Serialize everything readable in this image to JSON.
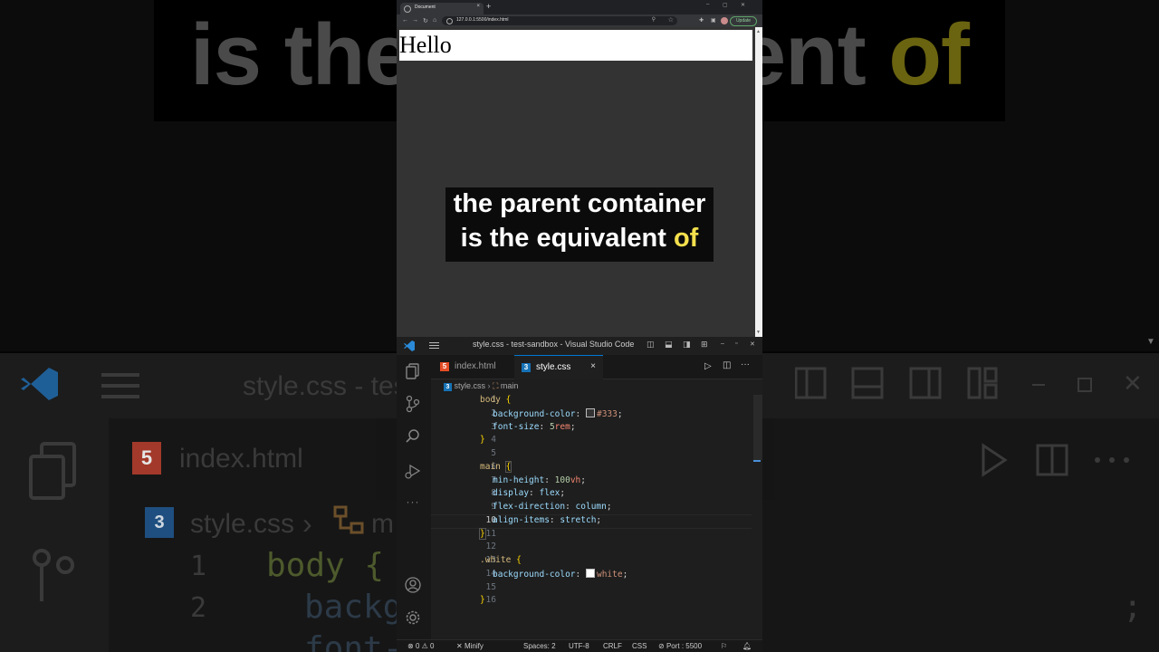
{
  "caption": {
    "line1": "the parent container",
    "line2_prefix": "is the equivalent",
    "line2_highlight": "of"
  },
  "background": {
    "caption_prefix": "is the",
    "caption_mid": "ent",
    "caption_hl": "of",
    "title": "style.css - tes",
    "tab1": "index.html",
    "crumb": "style.css",
    "crumb_symbol": "m",
    "ln1": "1",
    "ln2": "2",
    "code1": "body {",
    "code2": "backg",
    "code3": "font-",
    "code2_tail": ";"
  },
  "browser": {
    "tab_title": "Document",
    "tab_close": "×",
    "new_tab": "+",
    "url": "127.0.0.1:5500/index.html",
    "update_label": "Update",
    "page_text": "Hello"
  },
  "vscode": {
    "window_title": "style.css - test-sandbox - Visual Studio Code",
    "tabs": [
      {
        "label": "index.html"
      },
      {
        "label": "style.css",
        "close": "×"
      }
    ],
    "breadcrumb": {
      "file": "style.css",
      "symbol": "main"
    },
    "code": {
      "l1_sel": "body",
      "l1_brace": "{",
      "l2_prop": "background-color",
      "l2_val": "#333",
      "l3_prop": "font-size",
      "l3_num": "5",
      "l3_unit": "rem",
      "l4": "}",
      "l6_sel": "main",
      "l6_brace": "{",
      "l7_prop": "min-height",
      "l7_num": "100",
      "l7_unit": "vh",
      "l8_prop": "display",
      "l8_val": "flex",
      "l9_prop": "flex-direction",
      "l9_val": "column",
      "l10_prop": "align-items",
      "l10_val": "stretch",
      "l11": "}",
      "l13_sel": ".white",
      "l13_brace": "{",
      "l14_prop": "background-color",
      "l14_val": "white",
      "l16": "}"
    },
    "line_numbers": [
      "1",
      "2",
      "3",
      "4",
      "5",
      "6",
      "7",
      "8",
      "9",
      "10",
      "11",
      "12",
      "13",
      "14",
      "15",
      "16"
    ],
    "current_line": "10",
    "status": {
      "errors": "0",
      "warnings": "0",
      "minify": "Minify",
      "spaces": "Spaces: 2",
      "encoding": "UTF-8",
      "eol": "CRLF",
      "language": "CSS",
      "port": "Port : 5500"
    }
  },
  "colors": {
    "accent": "#0078d4",
    "caption_highlight": "#f4e04d",
    "css_selector": "#d7ba7d",
    "css_property": "#9cdcfe"
  }
}
